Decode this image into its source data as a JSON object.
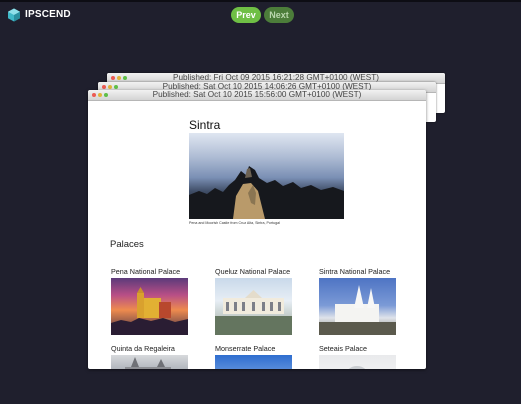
{
  "header": {
    "brand": "IPSCEND",
    "prev_label": "Prev",
    "next_label": "Next"
  },
  "windows": [
    {
      "title": "Published: Fri Oct 09 2015 16:21:28 GMT+0100 (WEST)"
    },
    {
      "title": "Published: Sat Oct 10 2015 14:06:26 GMT+0100 (WEST)"
    },
    {
      "title": "Published: Sat Oct 10 2015 15:56:00 GMT+0100 (WEST)"
    }
  ],
  "page": {
    "title": "Sintra",
    "hero_caption": "Pena and Moorish Castle from Cruz Alta, Sintra, Portugal",
    "section_title": "Palaces",
    "palaces": [
      {
        "name": "Pena National Palace"
      },
      {
        "name": "Queluz National Palace"
      },
      {
        "name": "Sintra National Palace"
      },
      {
        "name": "Quinta da Regaleira"
      },
      {
        "name": "Monserrate Palace"
      },
      {
        "name": "Seteais Palace"
      }
    ]
  },
  "colors": {
    "background": "#1f1f2d",
    "prev_button": "#6fbf45",
    "next_button": "#4c7d3a",
    "logo": "#3fb8c8"
  }
}
